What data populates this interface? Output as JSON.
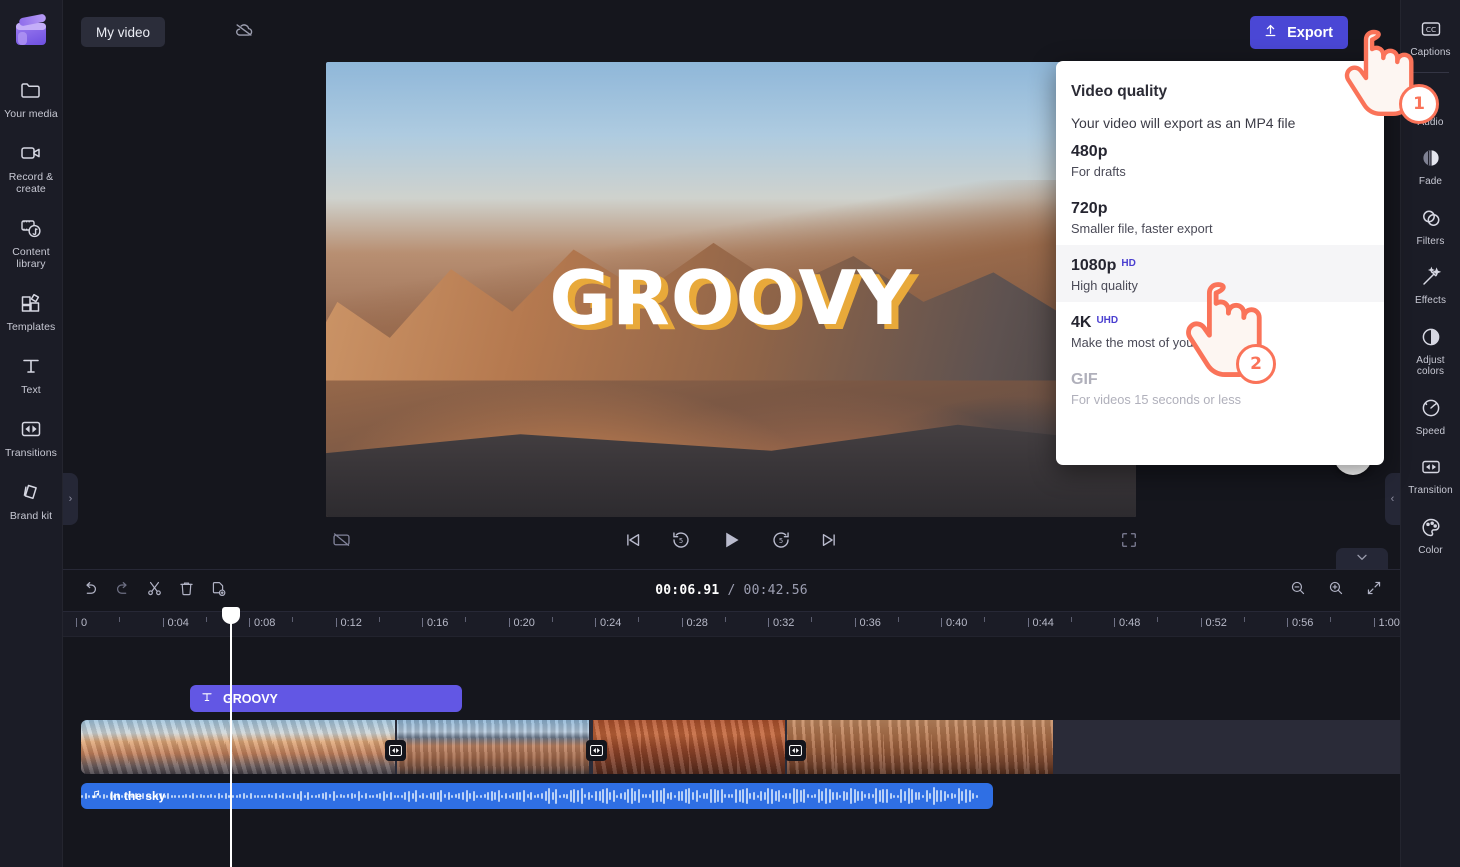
{
  "app": {
    "project_name": "My video",
    "logo_name": "clipchamp-logo"
  },
  "topbar": {
    "cloud_icon": "cloud-off-icon",
    "export_label": "Export",
    "export_icon": "upload-icon"
  },
  "left_sidebar": {
    "items": [
      {
        "label": "Your media",
        "icon": "folder-icon"
      },
      {
        "label": "Record & create",
        "icon": "video-camera-icon"
      },
      {
        "label": "Content library",
        "icon": "content-library-icon"
      },
      {
        "label": "Templates",
        "icon": "templates-icon"
      },
      {
        "label": "Text",
        "icon": "text-t-icon"
      },
      {
        "label": "Transitions",
        "icon": "transitions-icon"
      },
      {
        "label": "Brand kit",
        "icon": "brand-kit-icon"
      }
    ],
    "collapse_icon": "chevron-right-icon"
  },
  "right_sidebar": {
    "items": [
      {
        "label": "Captions",
        "icon": "cc-icon"
      },
      {
        "label": "Audio",
        "icon": "audio-icon"
      },
      {
        "label": "Fade",
        "icon": "fade-icon"
      },
      {
        "label": "Filters",
        "icon": "filters-icon"
      },
      {
        "label": "Effects",
        "icon": "effects-wand-icon"
      },
      {
        "label": "Adjust colors",
        "icon": "adjust-colors-icon"
      },
      {
        "label": "Speed",
        "icon": "speedometer-icon"
      },
      {
        "label": "Transition",
        "icon": "transition-icon"
      },
      {
        "label": "Color",
        "icon": "color-palette-icon"
      }
    ],
    "collapse_icon": "chevron-left-icon"
  },
  "preview": {
    "overlay_text": "GROOVY",
    "overlay_text_color": "#ffffff",
    "overlay_shadow_color": "#e8a93a",
    "captions_toggle_icon": "captions-off-icon",
    "controls": [
      {
        "name": "skip-to-start",
        "icon": "skip-start-icon"
      },
      {
        "name": "rewind-5",
        "icon": "rewind-5-icon"
      },
      {
        "name": "play",
        "icon": "play-icon"
      },
      {
        "name": "forward-5",
        "icon": "forward-5-icon"
      },
      {
        "name": "skip-to-end",
        "icon": "skip-end-icon"
      }
    ],
    "fullscreen_icon": "fullscreen-icon",
    "help_label": "?",
    "panel_toggle_icon": "chevron-down-icon"
  },
  "export_menu": {
    "title": "Video quality",
    "subtitle": "Your video will export as an MP4 file",
    "options": [
      {
        "name": "480p",
        "badge": "",
        "desc": "For drafts",
        "selected": false,
        "disabled": false
      },
      {
        "name": "720p",
        "badge": "",
        "desc": "Smaller file, faster export",
        "selected": false,
        "disabled": false
      },
      {
        "name": "1080p",
        "badge": "HD",
        "desc": "High quality",
        "selected": true,
        "disabled": false
      },
      {
        "name": "4K",
        "badge": "UHD",
        "desc": "Make the most of your 4K media",
        "selected": false,
        "disabled": false
      },
      {
        "name": "GIF",
        "badge": "",
        "desc": "For videos 15 seconds or less",
        "selected": false,
        "disabled": true
      }
    ],
    "badge_color": "#4a3fd0"
  },
  "timeline": {
    "toolbar_left": [
      {
        "name": "undo-button",
        "icon": "undo-icon"
      },
      {
        "name": "redo-button",
        "icon": "redo-icon"
      },
      {
        "name": "split-button",
        "icon": "scissors-icon"
      },
      {
        "name": "delete-button",
        "icon": "trash-icon"
      },
      {
        "name": "duplicate-button",
        "icon": "duplicate-icon"
      }
    ],
    "toolbar_right": [
      {
        "name": "zoom-out-button",
        "icon": "zoom-out-icon"
      },
      {
        "name": "zoom-in-button",
        "icon": "zoom-in-icon"
      },
      {
        "name": "fit-button",
        "icon": "fit-to-screen-icon"
      }
    ],
    "current_time": "00:06.91",
    "time_separator": " / ",
    "total_time": "00:42.56",
    "ruler_ticks": [
      "0",
      "0:04",
      "0:08",
      "0:12",
      "0:16",
      "0:20",
      "0:24",
      "0:28",
      "0:32",
      "0:36",
      "0:40",
      "0:44",
      "0:48",
      "0:52",
      "0:56",
      "1:00"
    ],
    "playhead_time": "00:06.91",
    "text_clip": {
      "label": "GROOVY",
      "icon": "text-t-icon",
      "color": "#6257e4"
    },
    "video_clip": {
      "transition_icon": "transition-icon",
      "transition_count": 3
    },
    "audio_clip": {
      "label": "In the sky",
      "icon": "music-note-icon",
      "color": "#2f6fe4"
    }
  },
  "annotations": [
    {
      "number": "1",
      "target": "export-button"
    },
    {
      "number": "2",
      "target": "1080p-option"
    }
  ]
}
